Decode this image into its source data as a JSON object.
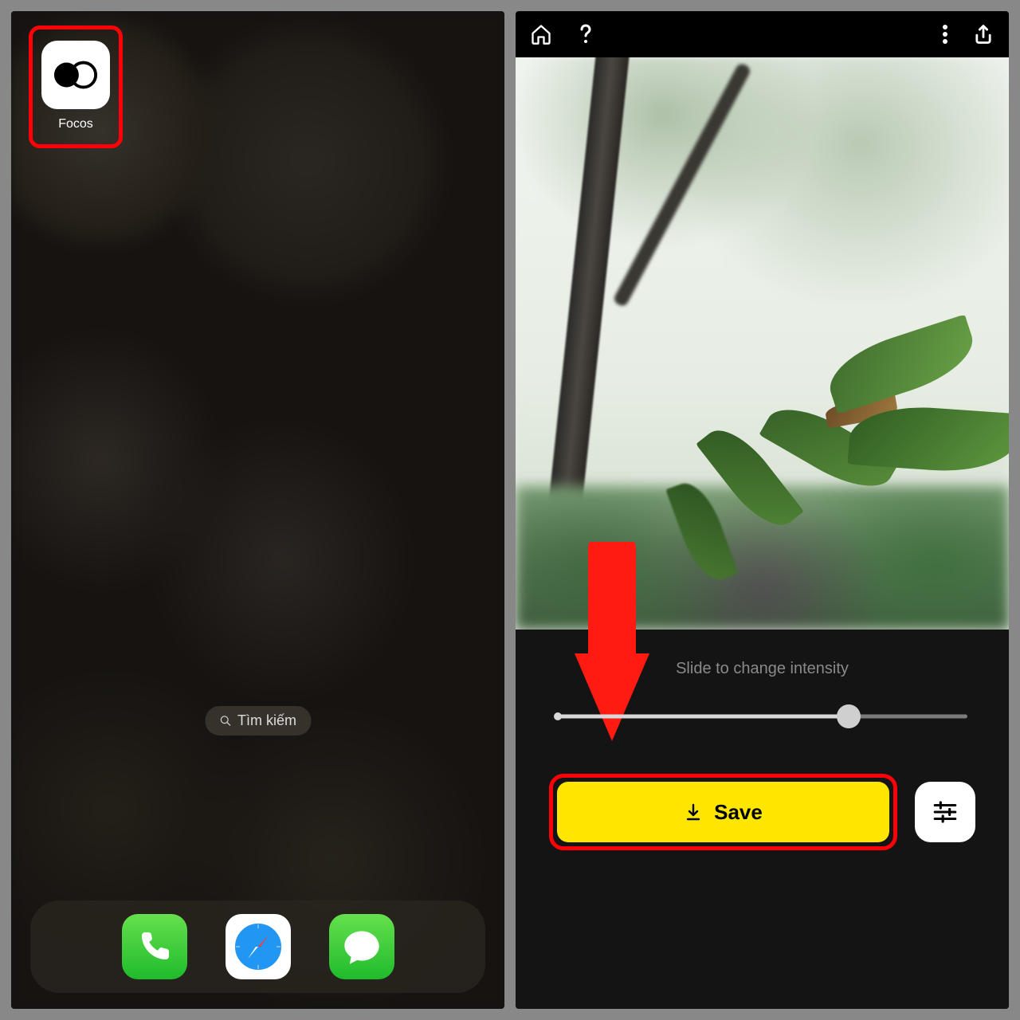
{
  "leftPane": {
    "highlightedApp": {
      "label": "Focos",
      "icon": "focos-icon"
    },
    "search": {
      "label": "Tìm kiếm",
      "icon": "search-icon"
    },
    "dock": [
      {
        "name": "Phone",
        "icon": "phone-icon"
      },
      {
        "name": "Safari",
        "icon": "safari-icon"
      },
      {
        "name": "Messages",
        "icon": "messages-icon"
      }
    ]
  },
  "rightPane": {
    "topbar": {
      "home": "home-icon",
      "help": "help-icon",
      "more": "more-icon",
      "share": "share-icon"
    },
    "slider": {
      "label": "Slide to change intensity",
      "valuePercent": 71
    },
    "saveButton": {
      "label": "Save",
      "icon": "download-icon"
    },
    "settingsButton": {
      "icon": "sliders-icon"
    },
    "annotations": {
      "arrow": "red-down-arrow",
      "appHighlightColor": "#ff0008",
      "saveHighlightColor": "#ff0008"
    }
  }
}
